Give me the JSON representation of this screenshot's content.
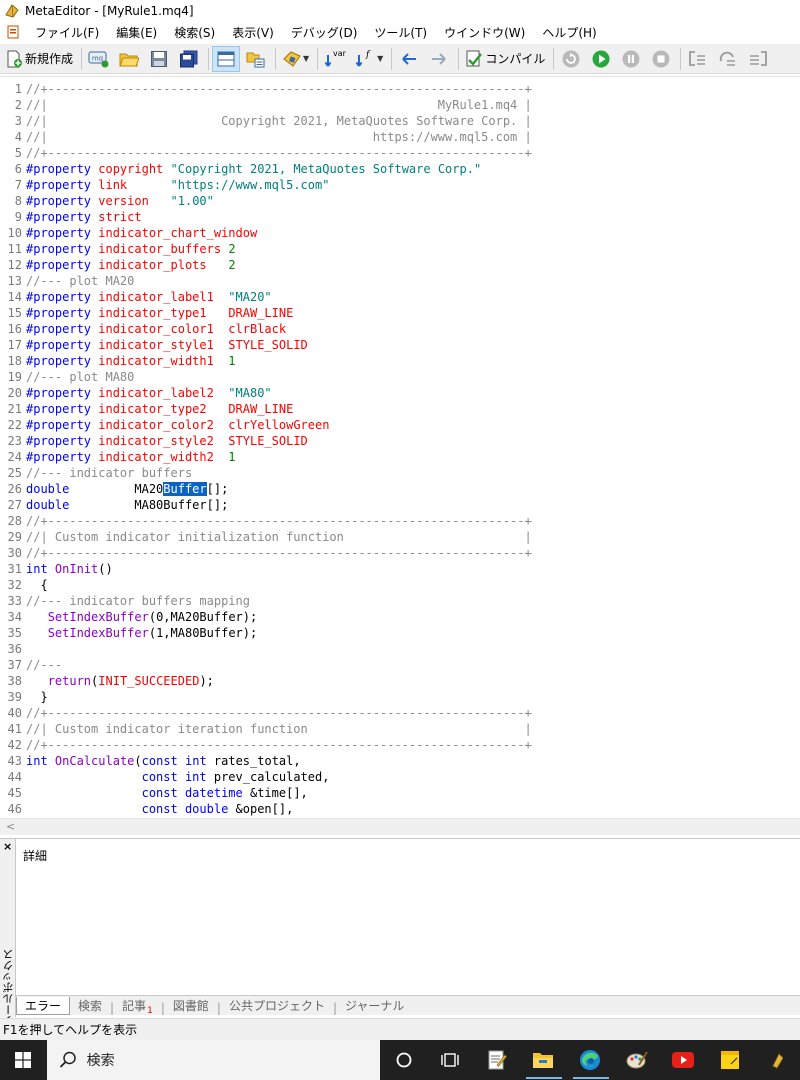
{
  "window": {
    "title": "MetaEditor - [MyRule1.mq4]"
  },
  "menu": [
    "ファイル(F)",
    "編集(E)",
    "検索(S)",
    "表示(V)",
    "デバッグ(D)",
    "ツール(T)",
    "ウインドウ(W)",
    "ヘルプ(H)"
  ],
  "toolbar": {
    "new_label": "新規作成",
    "compile_label": "コンパイル",
    "var_label": "var",
    "func_label": "f"
  },
  "code": [
    [
      [
        "c",
        "//+------------------------------------------------------------------+"
      ]
    ],
    [
      [
        "c",
        "//|                                                      MyRule1.mq4 |"
      ]
    ],
    [
      [
        "c",
        "//|                        Copyright 2021, MetaQuotes Software Corp. |"
      ]
    ],
    [
      [
        "c",
        "//|                                             https://www.mql5.com |"
      ]
    ],
    [
      [
        "c",
        "//+------------------------------------------------------------------+"
      ]
    ],
    [
      [
        "kw",
        "#property "
      ],
      [
        "pr",
        "copyright"
      ],
      [
        "t",
        " "
      ],
      [
        "s",
        "\"Copyright 2021, MetaQuotes Software Corp.\""
      ]
    ],
    [
      [
        "kw",
        "#property "
      ],
      [
        "pr",
        "link"
      ],
      [
        "t",
        "      "
      ],
      [
        "s",
        "\"https://www.mql5.com\""
      ]
    ],
    [
      [
        "kw",
        "#property "
      ],
      [
        "pr",
        "version"
      ],
      [
        "t",
        "   "
      ],
      [
        "s",
        "\"1.00\""
      ]
    ],
    [
      [
        "kw",
        "#property "
      ],
      [
        "pr",
        "strict"
      ]
    ],
    [
      [
        "kw",
        "#property "
      ],
      [
        "pr",
        "indicator_chart_window"
      ]
    ],
    [
      [
        "kw",
        "#property "
      ],
      [
        "pr",
        "indicator_buffers"
      ],
      [
        "t",
        " "
      ],
      [
        "n",
        "2"
      ]
    ],
    [
      [
        "kw",
        "#property "
      ],
      [
        "pr",
        "indicator_plots"
      ],
      [
        "t",
        "   "
      ],
      [
        "n",
        "2"
      ]
    ],
    [
      [
        "c",
        "//--- plot MA20"
      ]
    ],
    [
      [
        "kw",
        "#property "
      ],
      [
        "pr",
        "indicator_label1"
      ],
      [
        "t",
        "  "
      ],
      [
        "s",
        "\"MA20\""
      ]
    ],
    [
      [
        "kw",
        "#property "
      ],
      [
        "pr",
        "indicator_type1"
      ],
      [
        "t",
        "   "
      ],
      [
        "pr",
        "DRAW_LINE"
      ]
    ],
    [
      [
        "kw",
        "#property "
      ],
      [
        "pr",
        "indicator_color1"
      ],
      [
        "t",
        "  "
      ],
      [
        "pr",
        "clrBlack"
      ]
    ],
    [
      [
        "kw",
        "#property "
      ],
      [
        "pr",
        "indicator_style1"
      ],
      [
        "t",
        "  "
      ],
      [
        "pr",
        "STYLE_SOLID"
      ]
    ],
    [
      [
        "kw",
        "#property "
      ],
      [
        "pr",
        "indicator_width1"
      ],
      [
        "t",
        "  "
      ],
      [
        "n",
        "1"
      ]
    ],
    [
      [
        "c",
        "//--- plot MA80"
      ]
    ],
    [
      [
        "kw",
        "#property "
      ],
      [
        "pr",
        "indicator_label2"
      ],
      [
        "t",
        "  "
      ],
      [
        "s",
        "\"MA80\""
      ]
    ],
    [
      [
        "kw",
        "#property "
      ],
      [
        "pr",
        "indicator_type2"
      ],
      [
        "t",
        "   "
      ],
      [
        "pr",
        "DRAW_LINE"
      ]
    ],
    [
      [
        "kw",
        "#property "
      ],
      [
        "pr",
        "indicator_color2"
      ],
      [
        "t",
        "  "
      ],
      [
        "pr",
        "clrYellowGreen"
      ]
    ],
    [
      [
        "kw",
        "#property "
      ],
      [
        "pr",
        "indicator_style2"
      ],
      [
        "t",
        "  "
      ],
      [
        "pr",
        "STYLE_SOLID"
      ]
    ],
    [
      [
        "kw",
        "#property "
      ],
      [
        "pr",
        "indicator_width2"
      ],
      [
        "t",
        "  "
      ],
      [
        "n",
        "1"
      ]
    ],
    [
      [
        "c",
        "//--- indicator buffers"
      ]
    ],
    [
      [
        "kw",
        "double"
      ],
      [
        "t",
        "         MA20"
      ],
      [
        "sel",
        "Buffer"
      ],
      [
        "t",
        "[];"
      ]
    ],
    [
      [
        "kw",
        "double"
      ],
      [
        "t",
        "         MA80Buffer[];"
      ]
    ],
    [
      [
        "c",
        "//+------------------------------------------------------------------+"
      ]
    ],
    [
      [
        "c",
        "//| Custom indicator initialization function                         |"
      ]
    ],
    [
      [
        "c",
        "//+------------------------------------------------------------------+"
      ]
    ],
    [
      [
        "kw",
        "int"
      ],
      [
        "t",
        " "
      ],
      [
        "f",
        "OnInit"
      ],
      [
        "t",
        "()"
      ]
    ],
    [
      [
        "t",
        "  {"
      ]
    ],
    [
      [
        "c",
        "//--- indicator buffers mapping"
      ]
    ],
    [
      [
        "t",
        "   "
      ],
      [
        "f",
        "SetIndexBuffer"
      ],
      [
        "t",
        "(0,MA20Buffer);"
      ]
    ],
    [
      [
        "t",
        "   "
      ],
      [
        "f",
        "SetIndexBuffer"
      ],
      [
        "t",
        "(1,MA80Buffer);"
      ]
    ],
    [
      [
        "t",
        ""
      ]
    ],
    [
      [
        "c",
        "//---"
      ]
    ],
    [
      [
        "t",
        "   "
      ],
      [
        "f",
        "return"
      ],
      [
        "t",
        "("
      ],
      [
        "pr",
        "INIT_SUCCEEDED"
      ],
      [
        "t",
        ");"
      ]
    ],
    [
      [
        "t",
        "  }"
      ]
    ],
    [
      [
        "c",
        "//+------------------------------------------------------------------+"
      ]
    ],
    [
      [
        "c",
        "//| Custom indicator iteration function                              |"
      ]
    ],
    [
      [
        "c",
        "//+------------------------------------------------------------------+"
      ]
    ],
    [
      [
        "kw",
        "int"
      ],
      [
        "t",
        " "
      ],
      [
        "f",
        "OnCalculate"
      ],
      [
        "t",
        "("
      ],
      [
        "kw",
        "const int"
      ],
      [
        "t",
        " rates_total,"
      ]
    ],
    [
      [
        "t",
        "                "
      ],
      [
        "kw",
        "const int"
      ],
      [
        "t",
        " prev_calculated,"
      ]
    ],
    [
      [
        "t",
        "                "
      ],
      [
        "kw",
        "const datetime"
      ],
      [
        "t",
        " &time[],"
      ]
    ],
    [
      [
        "t",
        "                "
      ],
      [
        "kw",
        "const double"
      ],
      [
        "t",
        " &open[],"
      ]
    ]
  ],
  "toolbox": {
    "side_label": "ツールボックス",
    "header": "詳細",
    "tabs": [
      "エラー",
      "検索",
      "記事",
      "図書館",
      "公共プロジェクト",
      "ジャーナル"
    ],
    "article_badge": "1"
  },
  "status": {
    "text": "F1を押してヘルプを表示"
  },
  "taskbar": {
    "search_placeholder": "検索"
  },
  "colors": {
    "keyword": "#0000ff",
    "property": "#ff0000",
    "string": "#008080",
    "number": "#008000",
    "function": "#8b00c8",
    "comment": "#8a8a8a",
    "selection": "#0a64c8",
    "taskbar": "#202020"
  }
}
